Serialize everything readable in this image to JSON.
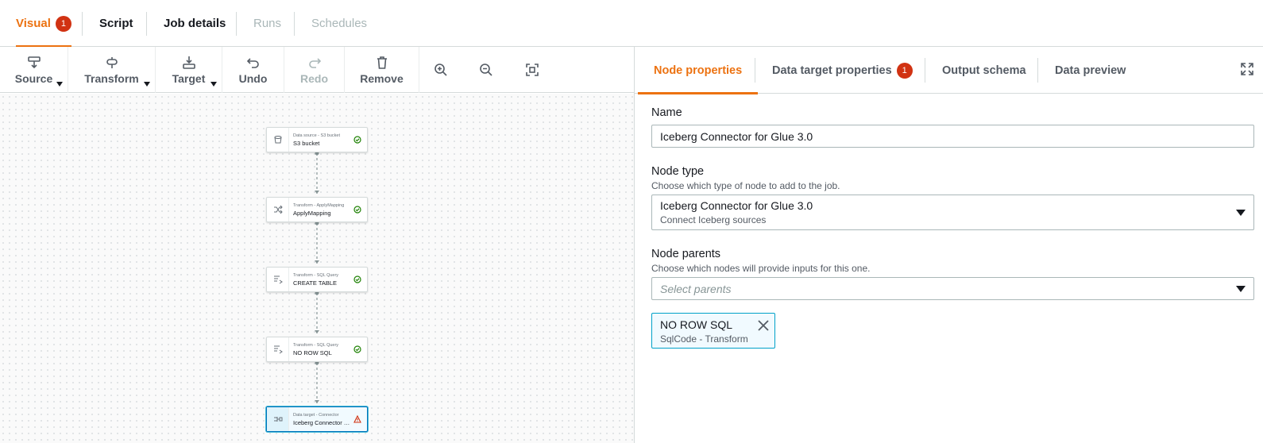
{
  "top_tabs": [
    {
      "label": "Visual",
      "badge": "1"
    },
    {
      "label": "Script"
    },
    {
      "label": "Job details"
    },
    {
      "label": "Runs"
    },
    {
      "label": "Schedules"
    }
  ],
  "toolbar": {
    "source": "Source",
    "transform": "Transform",
    "target": "Target",
    "undo": "Undo",
    "redo": "Redo",
    "remove": "Remove"
  },
  "nodes": [
    {
      "sub": "Data source - S3 bucket",
      "title": "S3 bucket",
      "icon": "bucket-icon",
      "status": "success"
    },
    {
      "sub": "Transform - ApplyMapping",
      "title": "ApplyMapping",
      "icon": "shuffle-icon",
      "status": "success"
    },
    {
      "sub": "Transform - SQL Query",
      "title": "CREATE TABLE",
      "icon": "sql-icon",
      "status": "success"
    },
    {
      "sub": "Transform - SQL Query",
      "title": "NO ROW SQL",
      "icon": "sql-icon",
      "status": "success"
    },
    {
      "sub": "Data target - Connector",
      "title": "Iceberg Connector fo...",
      "icon": "connector-icon",
      "status": "warning"
    }
  ],
  "right_tabs": [
    {
      "label": "Node properties"
    },
    {
      "label": "Data target properties",
      "badge": "1"
    },
    {
      "label": "Output schema"
    },
    {
      "label": "Data preview"
    }
  ],
  "form": {
    "name_label": "Name",
    "name_value": "Iceberg Connector for Glue 3.0",
    "node_type_label": "Node type",
    "node_type_desc": "Choose which type of node to add to the job.",
    "node_type_value": "Iceberg Connector for Glue 3.0",
    "node_type_sub": "Connect Iceberg sources",
    "parents_label": "Node parents",
    "parents_desc": "Choose which nodes will provide inputs for this one.",
    "parents_placeholder": "Select parents",
    "selected_parent_title": "NO ROW SQL",
    "selected_parent_sub": "SqlCode - Transform"
  },
  "colors": {
    "accent": "#ec7211",
    "badge": "#d13212",
    "success": "#1d8102",
    "selected_border": "#0073bb"
  }
}
